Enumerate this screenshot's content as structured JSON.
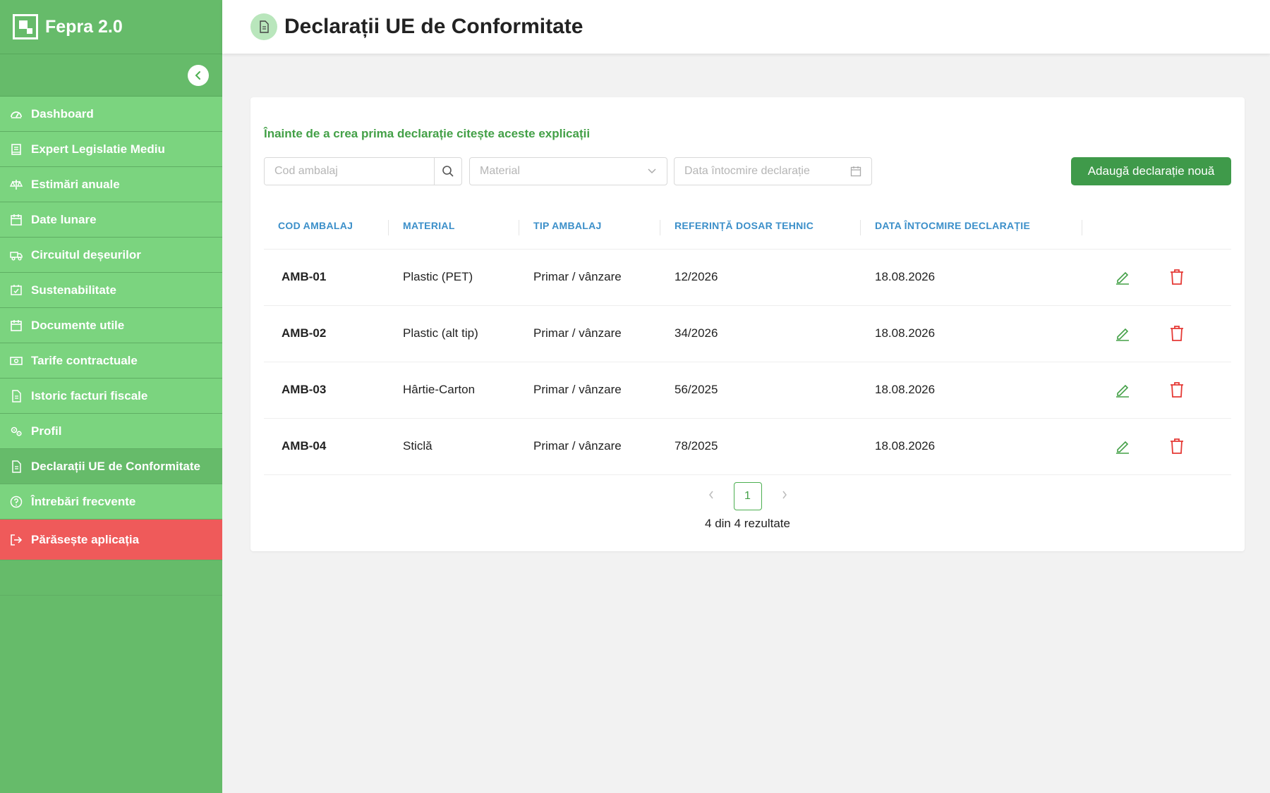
{
  "app": {
    "name": "Fepra 2.0"
  },
  "sidebar": {
    "items": [
      {
        "label": "Dashboard",
        "icon": "dashboard-icon"
      },
      {
        "label": "Expert Legislatie Mediu",
        "icon": "book-icon"
      },
      {
        "label": "Estimări anuale",
        "icon": "scale-icon"
      },
      {
        "label": "Date lunare",
        "icon": "calendar-icon"
      },
      {
        "label": "Circuitul deșeurilor",
        "icon": "truck-icon"
      },
      {
        "label": "Sustenabilitate",
        "icon": "calendar-check-icon"
      },
      {
        "label": "Documente utile",
        "icon": "calendar-icon"
      },
      {
        "label": "Tarife contractuale",
        "icon": "money-icon"
      },
      {
        "label": "Istoric facturi fiscale",
        "icon": "file-icon"
      },
      {
        "label": "Profil",
        "icon": "gears-icon"
      },
      {
        "label": "Declarații UE de Conformitate",
        "icon": "file-icon",
        "active": true
      },
      {
        "label": "Întrebări frecvente",
        "icon": "question-icon"
      }
    ],
    "logout_label": "Părăsește aplicația"
  },
  "header": {
    "title": "Declarații UE de Conformitate"
  },
  "main": {
    "info_link": "Înainte de a crea prima declarație citește aceste explicații",
    "filters": {
      "code_placeholder": "Cod ambalaj",
      "material_placeholder": "Material",
      "date_placeholder": "Data întocmire declarație"
    },
    "add_button": "Adaugă declarație nouă",
    "table": {
      "columns": [
        "COD AMBALAJ",
        "MATERIAL",
        "TIP AMBALAJ",
        "REFERINȚĂ DOSAR TEHNIC",
        "DATA ÎNTOCMIRE DECLARAȚIE"
      ],
      "rows": [
        {
          "code": "AMB-01",
          "material": "Plastic (PET)",
          "type": "Primar / vânzare",
          "ref": "12/2026",
          "date": "18.08.2026"
        },
        {
          "code": "AMB-02",
          "material": "Plastic (alt tip)",
          "type": "Primar / vânzare",
          "ref": "34/2026",
          "date": "18.08.2026"
        },
        {
          "code": "AMB-03",
          "material": "Hârtie-Carton",
          "type": "Primar / vânzare",
          "ref": "56/2025",
          "date": "18.08.2026"
        },
        {
          "code": "AMB-04",
          "material": "Sticlă",
          "type": "Primar / vânzare",
          "ref": "78/2025",
          "date": "18.08.2026"
        }
      ]
    },
    "pagination": {
      "current_page": "1",
      "results_text": "4 din 4 rezultate"
    }
  },
  "colors": {
    "sidebar": "#66bb6a",
    "nav_item": "#7bd47f",
    "logout": "#ef5a5a",
    "primary_button": "#3f9a4a",
    "header_text": "#3b8fc9",
    "delete": "#e53935"
  }
}
